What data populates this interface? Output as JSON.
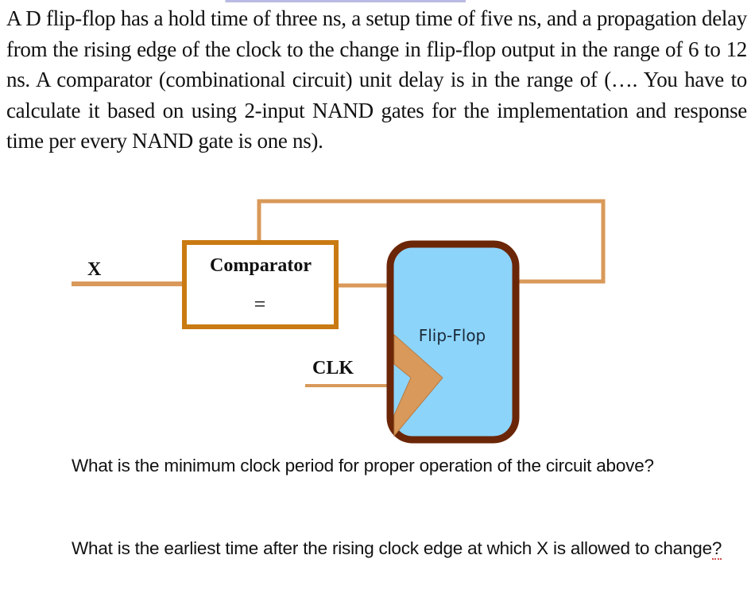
{
  "problem": {
    "text": "A D flip-flop has a hold time of three ns, a setup time of five ns, and a propagation delay from the rising edge of the clock to the change in flip-flop output in the range of 6 to 12 ns. A comparator (combinational circuit) unit delay is in the range of (…. You have to calculate it based on using 2-input NAND gates for the implementation and response time per every NAND gate is one ns)."
  },
  "diagram": {
    "input_label": "X",
    "comparator_label": "Comparator",
    "comparator_symbol": "=",
    "clock_label": "CLK",
    "flipflop_label": "Flip-Flop",
    "colors": {
      "wire": "#d9995a",
      "comparator_border": "#c97a12",
      "flipflop_border": "#6b2608",
      "flipflop_fill": "#8dd4fb",
      "clock_triangle": "#d9995a"
    }
  },
  "questions": [
    {
      "text": "What is the minimum clock period for proper operation of the circuit above?"
    },
    {
      "text_main": "What is the earliest time after the rising clock edge at which X is allowed to change",
      "text_end": "?"
    }
  ]
}
